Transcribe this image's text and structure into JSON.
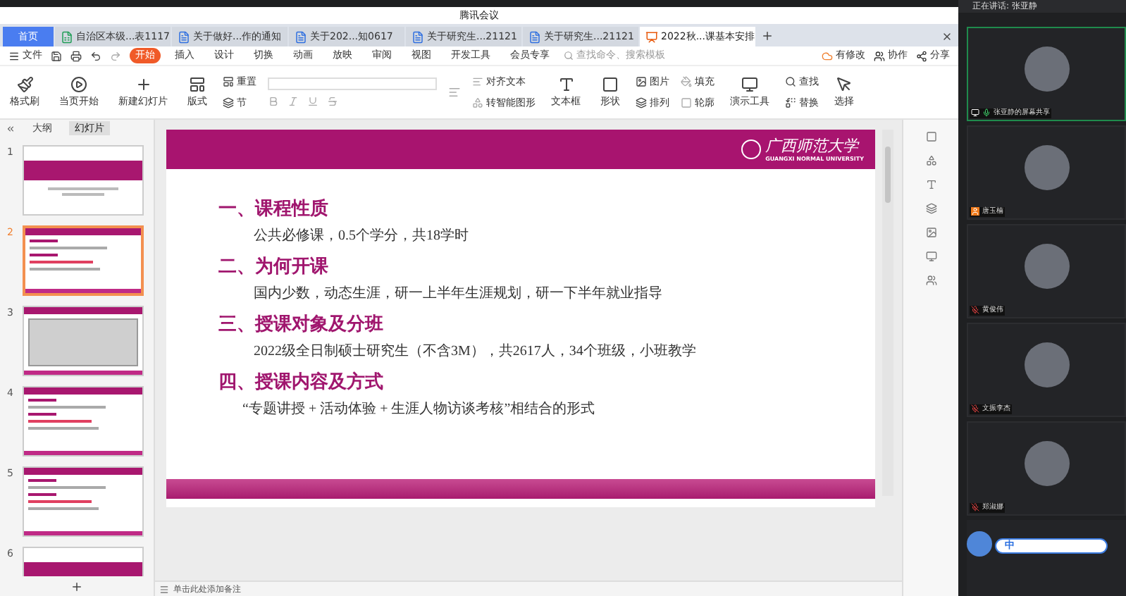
{
  "window": {
    "title": "腾讯会议"
  },
  "doc_tabs": [
    {
      "label": "首页",
      "kind": "home",
      "selected": false
    },
    {
      "label": "自治区本级...表1117",
      "kind": "sheet",
      "selected": false
    },
    {
      "label": "关于做好...作的通知",
      "kind": "doc",
      "selected": false
    },
    {
      "label": "关于202...知0617",
      "kind": "doc",
      "selected": false
    },
    {
      "label": "关于研究生...21121",
      "kind": "doc",
      "selected": false
    },
    {
      "label": "关于研究生...21121",
      "kind": "doc",
      "selected": false
    },
    {
      "label": "2022秋...课基本安排",
      "kind": "slides",
      "selected": true
    }
  ],
  "menu": {
    "file": "文件",
    "items": [
      {
        "label": "开始",
        "selected": true
      },
      {
        "label": "插入",
        "selected": false
      },
      {
        "label": "设计",
        "selected": false
      },
      {
        "label": "切换",
        "selected": false
      },
      {
        "label": "动画",
        "selected": false
      },
      {
        "label": "放映",
        "selected": false
      },
      {
        "label": "审阅",
        "selected": false
      },
      {
        "label": "视图",
        "selected": false
      },
      {
        "label": "开发工具",
        "selected": false
      },
      {
        "label": "会员专享",
        "selected": false
      }
    ],
    "search": {
      "placeholder": "查找命令、搜索模板"
    },
    "actions": [
      "有修改",
      "协作",
      "分享"
    ]
  },
  "ribbon": {
    "format_painter": "格式刷",
    "play": "当页开始",
    "new_slide": "新建幻灯片",
    "layout": "版式",
    "reset": "重置",
    "section": "节",
    "align_text": "对齐文本",
    "smart_art": "转智能图形",
    "text_box": "文本框",
    "shape": "形状",
    "picture": "图片",
    "fill": "填充",
    "arrange": "排列",
    "outline": "轮廓",
    "tools": "演示工具",
    "find": "查找",
    "replace": "替换",
    "select": "选择"
  },
  "left_panel": {
    "tabs": [
      {
        "label": "大纲",
        "selected": false
      },
      {
        "label": "幻灯片",
        "selected": true
      }
    ],
    "slides": [
      {
        "number": "1",
        "kind": "title",
        "selected": false
      },
      {
        "number": "2",
        "kind": "list",
        "selected": true
      },
      {
        "number": "3",
        "kind": "table",
        "selected": false
      },
      {
        "number": "4",
        "kind": "list",
        "selected": false
      },
      {
        "number": "5",
        "kind": "list",
        "selected": false
      },
      {
        "number": "6",
        "kind": "title",
        "selected": false
      }
    ]
  },
  "slide": {
    "logo_name": "广西师范大学",
    "logo_subtitle": "GUANGXI NORMAL UNIVERSITY",
    "sections": [
      {
        "heading": "一、课程性质",
        "body": "公共必修课，0.5个学分，共18学时"
      },
      {
        "heading": "二、为何开课",
        "body": "国内少数，动态生涯，研一上半年生涯规划，研一下半年就业指导"
      },
      {
        "heading": "三、授课对象及分班",
        "body": "2022级全日制硕士研究生（不含3M），共2617人，34个班级，小班教学"
      },
      {
        "heading": "四、授课内容及方式",
        "body": "“专题讲授 + 活动体验 + 生涯人物访谈考核”相结合的形式"
      }
    ]
  },
  "notes": {
    "placeholder": "单击此处添加备注"
  },
  "meeting": {
    "speaking": "正在讲话: 张亚静",
    "participants": [
      {
        "name": "张亚静的屏幕共享",
        "kind": "screen",
        "selected": true
      },
      {
        "name": "唐玉楠",
        "kind": "host",
        "selected": false
      },
      {
        "name": "黄俊伟",
        "kind": "muted",
        "selected": false
      },
      {
        "name": "文振李杰",
        "kind": "muted",
        "selected": false
      },
      {
        "name": "郑淑娜",
        "kind": "muted",
        "selected": false
      }
    ],
    "ime": {
      "label": "中"
    }
  }
}
